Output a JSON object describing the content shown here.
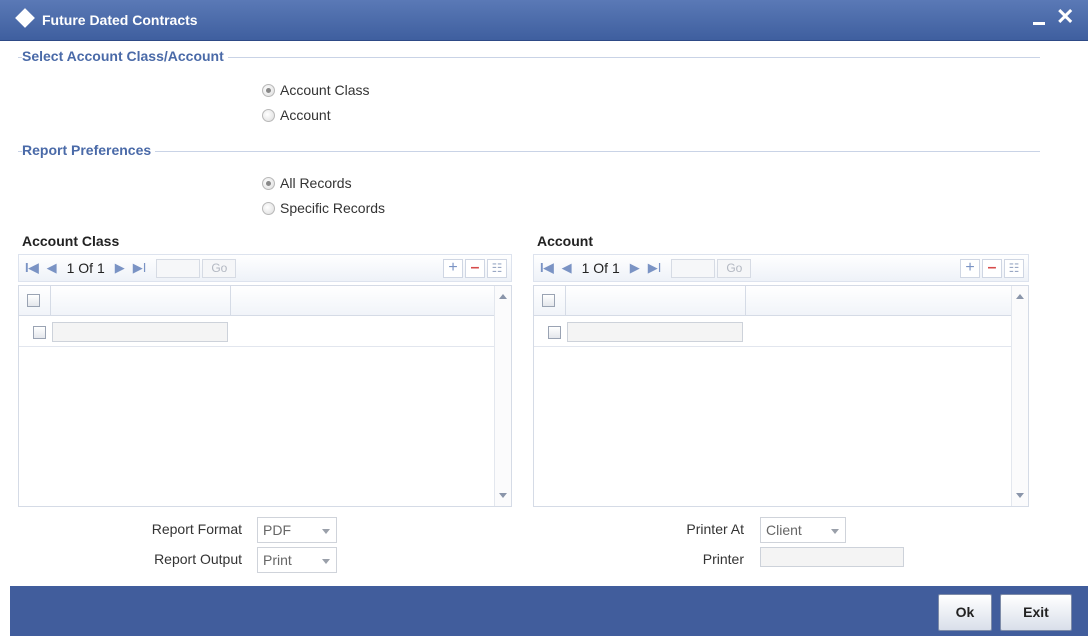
{
  "window": {
    "title": "Future Dated Contracts",
    "minimize_glyph": "–",
    "close_glyph": "✕"
  },
  "sections": {
    "select_account": "Select Account Class/Account",
    "report_preferences": "Report Preferences"
  },
  "select_account_options": [
    {
      "label": "Account Class",
      "selected": true
    },
    {
      "label": "Account",
      "selected": false
    }
  ],
  "report_preference_options": [
    {
      "label": "All Records",
      "selected": true
    },
    {
      "label": "Specific Records",
      "selected": false
    }
  ],
  "account_class_grid": {
    "title": "Account Class",
    "page_text": "1 Of 1",
    "go_label": "Go",
    "add_glyph": "+",
    "remove_glyph": "–",
    "list_glyph": "☷"
  },
  "account_grid": {
    "title": "Account",
    "page_text": "1 Of 1",
    "go_label": "Go",
    "add_glyph": "+",
    "remove_glyph": "–",
    "list_glyph": "☷"
  },
  "nav_icons": {
    "first": "I◀",
    "prev": "◀",
    "next": "▶",
    "last": "▶I"
  },
  "report_format": {
    "label": "Report Format",
    "value": "PDF"
  },
  "report_output": {
    "label": "Report Output",
    "value": "Print"
  },
  "printer_at": {
    "label": "Printer At",
    "value": "Client"
  },
  "printer": {
    "label": "Printer",
    "value": ""
  },
  "footer": {
    "ok_label": "Ok",
    "exit_label": "Exit"
  },
  "colors": {
    "title_bar": "#4a69aa",
    "footer": "#415d9c",
    "section_text": "#4a6aa8"
  }
}
